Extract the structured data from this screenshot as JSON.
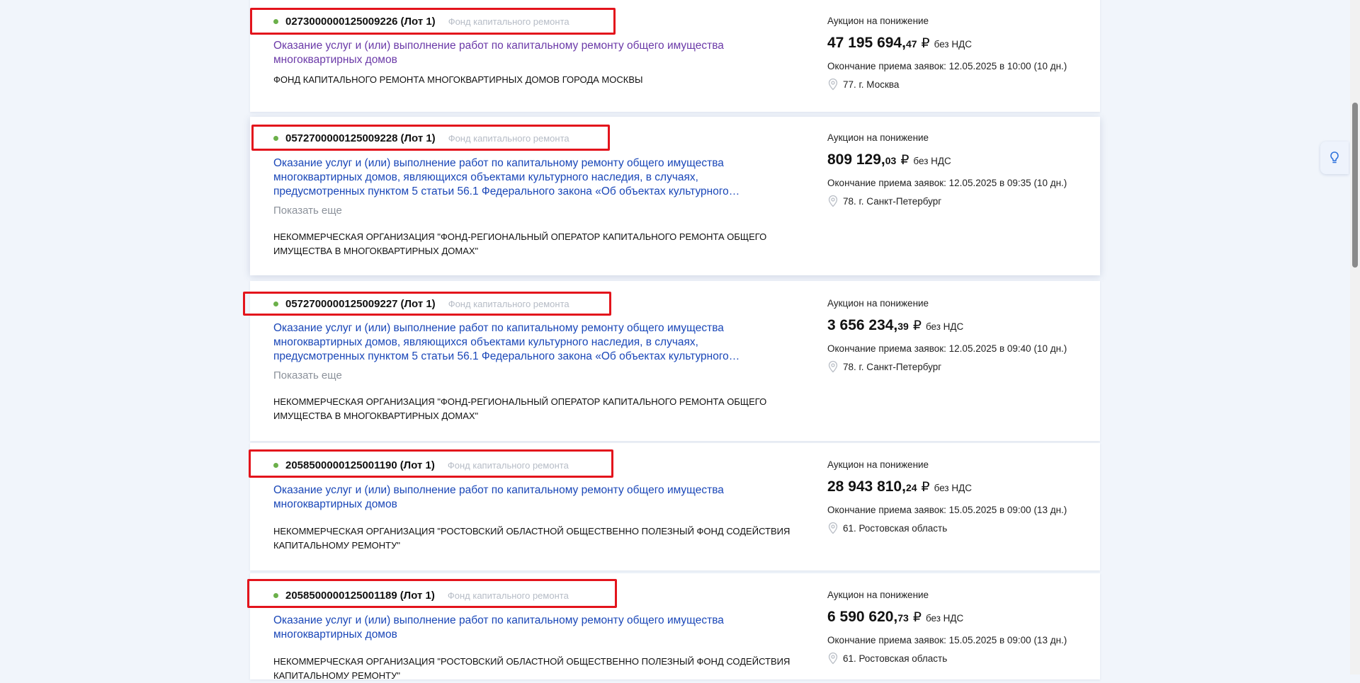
{
  "hint_icon": "lightbulb-icon",
  "cards": [
    {
      "number": "0273000000125009226",
      "lot": "(Лот 1)",
      "category": "Фонд капитального ремонта",
      "title": "Оказание услуг и (или) выполнение работ по капитальному ремонту общего имущества многоквартирных домов",
      "show_more": "",
      "organization": "ФОНД КАПИТАЛЬНОГО РЕМОНТА МНОГОКВАРТИРНЫХ ДОМОВ ГОРОДА МОСКВЫ",
      "procedure": "Аукцион на понижение",
      "price_int": "47 195 694,",
      "price_frac": "47",
      "currency": "₽",
      "vat": "без НДС",
      "deadline": "Окончание приема заявок: 12.05.2025 в 10:00 (10 дн.)",
      "region": "77. г. Москва"
    },
    {
      "number": "0572700000125009228",
      "lot": "(Лот 1)",
      "category": "Фонд капитального ремонта",
      "title": "Оказание услуг и (или) выполнение работ по капитальному ремонту общего имущества многоквартирных домов, являющихся объектами культурного наследия, в случаях, предусмотренных пунктом 5 статьи 56.1 Федерального закона «Об объектах культурного…",
      "show_more": "Показать еще",
      "organization": "НЕКОММЕРЧЕСКАЯ ОРГАНИЗАЦИЯ \"ФОНД-РЕГИОНАЛЬНЫЙ ОПЕРАТОР КАПИТАЛЬНОГО РЕМОНТА ОБЩЕГО ИМУЩЕСТВА В МНОГОКВАРТИРНЫХ ДОМАХ\"",
      "procedure": "Аукцион на понижение",
      "price_int": "809 129,",
      "price_frac": "03",
      "currency": "₽",
      "vat": "без НДС",
      "deadline": "Окончание приема заявок: 12.05.2025 в 09:35 (10 дн.)",
      "region": "78. г. Санкт-Петербург"
    },
    {
      "number": "0572700000125009227",
      "lot": "(Лот 1)",
      "category": "Фонд капитального ремонта",
      "title": "Оказание услуг и (или) выполнение работ по капитальному ремонту общего имущества многоквартирных домов, являющихся объектами культурного наследия, в случаях, предусмотренных пунктом 5 статьи 56.1 Федерального закона «Об объектах культурного…",
      "show_more": "Показать еще",
      "organization": "НЕКОММЕРЧЕСКАЯ ОРГАНИЗАЦИЯ \"ФОНД-РЕГИОНАЛЬНЫЙ ОПЕРАТОР КАПИТАЛЬНОГО РЕМОНТА ОБЩЕГО ИМУЩЕСТВА В МНОГОКВАРТИРНЫХ ДОМАХ\"",
      "procedure": "Аукцион на понижение",
      "price_int": "3 656 234,",
      "price_frac": "39",
      "currency": "₽",
      "vat": "без НДС",
      "deadline": "Окончание приема заявок: 12.05.2025 в 09:40 (10 дн.)",
      "region": "78. г. Санкт-Петербург"
    },
    {
      "number": "2058500000125001190",
      "lot": "(Лот 1)",
      "category": "Фонд капитального ремонта",
      "title": "Оказание услуг и (или) выполнение работ по капитальному ремонту общего имущества многоквартирных домов",
      "show_more": "",
      "organization": "НЕКОММЕРЧЕСКАЯ ОРГАНИЗАЦИЯ \"РОСТОВСКИЙ ОБЛАСТНОЙ ОБЩЕСТВЕННО ПОЛЕЗНЫЙ ФОНД СОДЕЙСТВИЯ КАПИТАЛЬНОМУ РЕМОНТУ\"",
      "procedure": "Аукцион на понижение",
      "price_int": "28 943 810,",
      "price_frac": "24",
      "currency": "₽",
      "vat": "без НДС",
      "deadline": "Окончание приема заявок: 15.05.2025 в 09:00 (13 дн.)",
      "region": "61. Ростовская область"
    },
    {
      "number": "2058500000125001189",
      "lot": "(Лот 1)",
      "category": "Фонд капитального ремонта",
      "title": "Оказание услуг и (или) выполнение работ по капитальному ремонту общего имущества многоквартирных домов",
      "show_more": "",
      "organization": "НЕКОММЕРЧЕСКАЯ ОРГАНИЗАЦИЯ \"РОСТОВСКИЙ ОБЛАСТНОЙ ОБЩЕСТВЕННО ПОЛЕЗНЫЙ ФОНД СОДЕЙСТВИЯ КАПИТАЛЬНОМУ РЕМОНТУ\"",
      "procedure": "Аукцион на понижение",
      "price_int": "6 590 620,",
      "price_frac": "73",
      "currency": "₽",
      "vat": "без НДС",
      "deadline": "Окончание приема заявок: 15.05.2025 в 09:00 (13 дн.)",
      "region": "61. Ростовская область"
    }
  ]
}
